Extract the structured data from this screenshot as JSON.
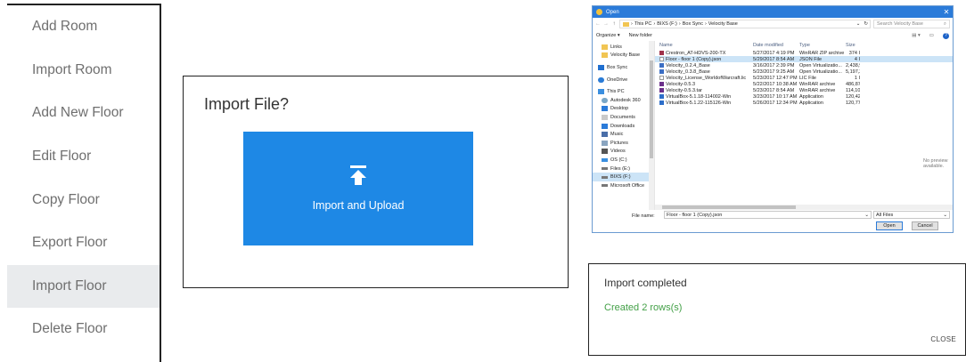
{
  "menu": {
    "items": [
      {
        "label": "Add Room"
      },
      {
        "label": "Import Room"
      },
      {
        "label": "Add New Floor"
      },
      {
        "label": "Edit Floor"
      },
      {
        "label": "Copy Floor"
      },
      {
        "label": "Export Floor"
      },
      {
        "label": "Import Floor",
        "active": true
      },
      {
        "label": "Delete Floor"
      }
    ]
  },
  "import_dialog": {
    "title": "Import File?",
    "upload_button_label": "Import and Upload",
    "button_color": "#1e88e5"
  },
  "file_dialog": {
    "title": "Open",
    "address": [
      "This PC",
      "BIXS (F:)",
      "Box Sync",
      "Velocity Base"
    ],
    "search_placeholder": "Search Velocity Base",
    "toolbar": {
      "organize": "Organize ▾",
      "new_folder": "New folder"
    },
    "nav_items": [
      {
        "label": "Links",
        "icon": "folder-icon"
      },
      {
        "label": "Velocity Base",
        "icon": "folder-icon"
      },
      {
        "label": "Box Sync",
        "icon": "box-icon"
      },
      {
        "label": "OneDrive",
        "icon": "cloud-icon"
      },
      {
        "label": "This PC",
        "icon": "pc-icon"
      },
      {
        "label": "Autodesk 360",
        "icon": "cloud-icon"
      },
      {
        "label": "Desktop",
        "icon": "desktop-icon"
      },
      {
        "label": "Documents",
        "icon": "documents-icon"
      },
      {
        "label": "Downloads",
        "icon": "download-icon"
      },
      {
        "label": "Music",
        "icon": "music-icon"
      },
      {
        "label": "Pictures",
        "icon": "pictures-icon"
      },
      {
        "label": "Videos",
        "icon": "videos-icon"
      },
      {
        "label": "OS (C:)",
        "icon": "drive-icon"
      },
      {
        "label": "Files (E:)",
        "icon": "drive-icon"
      },
      {
        "label": "BIXS (F:)",
        "icon": "drive-icon"
      },
      {
        "label": "Microsoft Office",
        "icon": "drive-icon"
      }
    ],
    "columns": {
      "name": "Name",
      "date": "Date modified",
      "type": "Type",
      "size": "Size"
    },
    "files": [
      {
        "name": "Crestron_AT-HDVS-200-TX",
        "date": "5/27/2017 4:19 PM",
        "type": "WinRAR ZIP archive",
        "size": "374 I",
        "icon": "zip-icon"
      },
      {
        "name": "Floor - floor 1 (Copy).json",
        "date": "5/29/2017 8:54 AM",
        "type": "JSON File",
        "size": "4 I",
        "icon": "file-icon",
        "selected": true
      },
      {
        "name": "Velocity_0.2.4_Base",
        "date": "3/16/2017 2:39 PM",
        "type": "Open Virtualizatio...",
        "size": "2,438,950 I",
        "icon": "vm-icon"
      },
      {
        "name": "Velocity_0.3.8_Base",
        "date": "5/23/2017 9:25 AM",
        "type": "Open Virtualizatio...",
        "size": "5,197,294 I",
        "icon": "vm-icon"
      },
      {
        "name": "Velocity_License_WorldofWarcraft.lic",
        "date": "5/23/2017 12:47 PM",
        "type": "LIC File",
        "size": "1 I",
        "icon": "file-icon"
      },
      {
        "name": "Velocity-0.5.3",
        "date": "5/22/2017 10:38 AM",
        "type": "WinRAR archive",
        "size": "486,870 I",
        "icon": "rar-icon"
      },
      {
        "name": "Velocity-0.5.3.tar",
        "date": "5/23/2017 8:54 AM",
        "type": "WinRAR archive",
        "size": "114,107 I",
        "icon": "rar-icon"
      },
      {
        "name": "VirtualBox-5.1.18-114002-Win",
        "date": "3/23/2017 10:17 AM",
        "type": "Application",
        "size": "120,421 I",
        "icon": "app-icon"
      },
      {
        "name": "VirtualBox-5.1.22-115126-Win",
        "date": "5/26/2017 12:34 PM",
        "type": "Application",
        "size": "120,772 I",
        "icon": "app-icon"
      }
    ],
    "preview_text": "No preview available.",
    "filename_label": "File name:",
    "filename_value": "Floor - floor 1 (Copy).json",
    "filetype_value": "All Files",
    "open_label": "Open",
    "cancel_label": "Cancel"
  },
  "done_dialog": {
    "title": "Import completed",
    "message": "Created 2 rows(s)",
    "close_label": "CLOSE",
    "message_color": "#43a047"
  }
}
